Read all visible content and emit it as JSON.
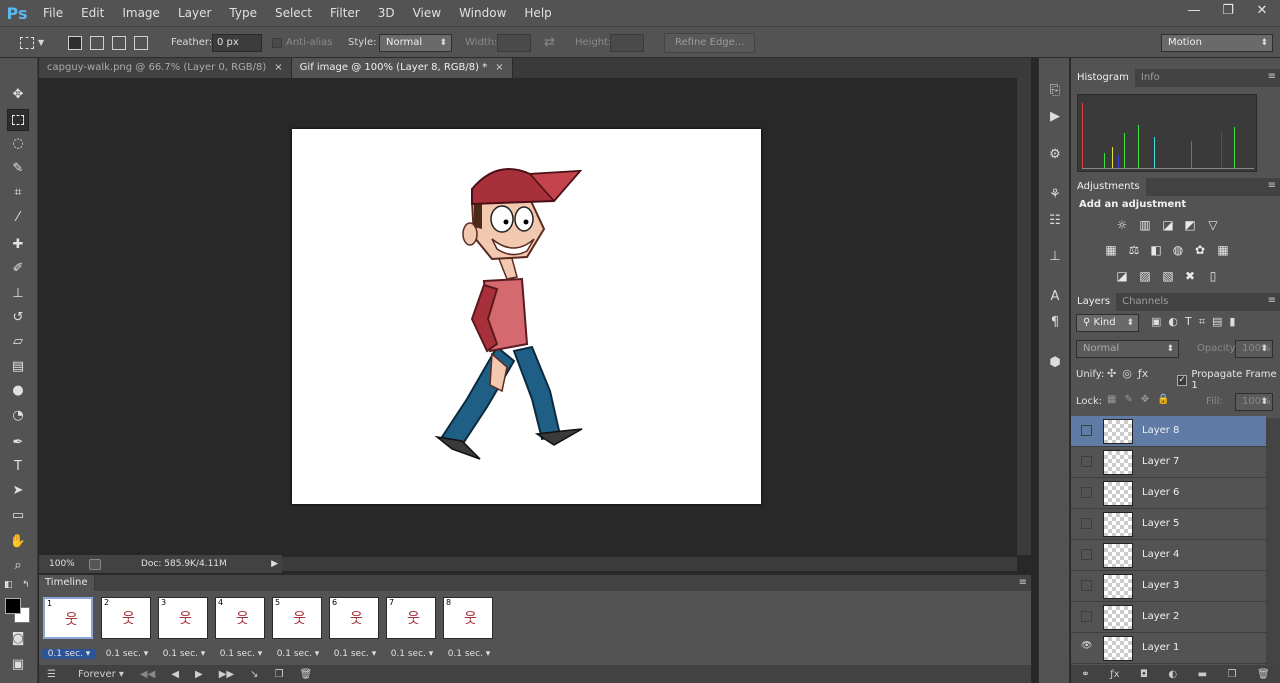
{
  "app": {
    "logo": "Ps"
  },
  "menu": [
    "File",
    "Edit",
    "Image",
    "Layer",
    "Type",
    "Select",
    "Filter",
    "3D",
    "View",
    "Window",
    "Help"
  ],
  "window_controls": {
    "minimize": "—",
    "maximize": "❐",
    "close": "✕"
  },
  "options": {
    "feather_label": "Feather:",
    "feather_value": "0 px",
    "antialias_label": "Anti-alias",
    "style_label": "Style:",
    "style_value": "Normal",
    "width_label": "Width:",
    "height_label": "Height:",
    "refine_edge": "Refine Edge...",
    "workspace": "Motion"
  },
  "doc_tabs": [
    {
      "title": "capguy-walk.png @ 66.7% (Layer 0, RGB/8)",
      "close": "×",
      "active": false
    },
    {
      "title": "Gif image @ 100% (Layer 8, RGB/8) *",
      "close": "×",
      "active": true
    }
  ],
  "status": {
    "zoom": "100%",
    "doc": "Doc: 585.9K/4.11M"
  },
  "timeline": {
    "title": "Timeline",
    "frames": [
      {
        "num": "1",
        "delay": "0.1 sec."
      },
      {
        "num": "2",
        "delay": "0.1 sec."
      },
      {
        "num": "3",
        "delay": "0.1 sec."
      },
      {
        "num": "4",
        "delay": "0.1 sec."
      },
      {
        "num": "5",
        "delay": "0.1 sec."
      },
      {
        "num": "6",
        "delay": "0.1 sec."
      },
      {
        "num": "7",
        "delay": "0.1 sec."
      },
      {
        "num": "8",
        "delay": "0.1 sec."
      }
    ],
    "loop": "Forever"
  },
  "panels": {
    "histogram_tab": "Histogram",
    "info_tab": "Info",
    "adjustments_tab": "Adjustments",
    "add_adjustment": "Add an adjustment",
    "layers_tab": "Layers",
    "channels_tab": "Channels",
    "kind_filter": "Kind",
    "blend_mode": "Normal",
    "opacity_label": "Opacity:",
    "opacity_value": "100%",
    "unify_label": "Unify:",
    "propagate": "Propagate Frame 1",
    "lock_label": "Lock:",
    "fill_label": "Fill:",
    "fill_value": "100%"
  },
  "layers": [
    {
      "name": "Layer 8",
      "visible": false,
      "selected": true
    },
    {
      "name": "Layer 7",
      "visible": false,
      "selected": false
    },
    {
      "name": "Layer 6",
      "visible": false,
      "selected": false
    },
    {
      "name": "Layer 5",
      "visible": false,
      "selected": false
    },
    {
      "name": "Layer 4",
      "visible": false,
      "selected": false
    },
    {
      "name": "Layer 3",
      "visible": false,
      "selected": false
    },
    {
      "name": "Layer 2",
      "visible": false,
      "selected": false
    },
    {
      "name": "Layer 1",
      "visible": true,
      "selected": false
    }
  ],
  "colors": {
    "accent": "#5f7ba6",
    "ps_blue": "#5ab8f0",
    "cap_red": "#a8303a",
    "pants_blue": "#1f5f86"
  }
}
